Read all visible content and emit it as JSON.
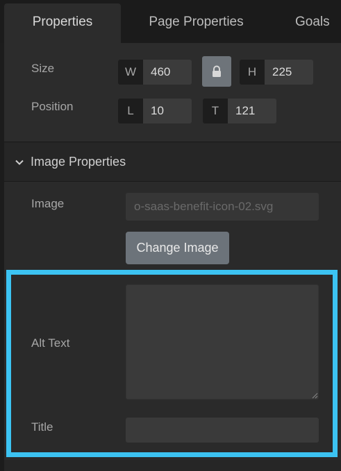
{
  "tabs": [
    {
      "label": "Properties",
      "active": true
    },
    {
      "label": "Page Properties",
      "active": false
    },
    {
      "label": "Goals",
      "active": false
    }
  ],
  "dimensions": {
    "size_label": "Size",
    "position_label": "Position",
    "width": {
      "prefix": "W",
      "value": "460"
    },
    "height": {
      "prefix": "H",
      "value": "225"
    },
    "left": {
      "prefix": "L",
      "value": "10"
    },
    "top": {
      "prefix": "T",
      "value": "121"
    },
    "lock_icon": "lock-icon"
  },
  "image_properties": {
    "header": "Image Properties",
    "header_icon": "chevron-down-icon",
    "image_label": "Image",
    "image_name": "o-saas-benefit-icon-02.svg",
    "change_button": "Change Image",
    "alt_text_label": "Alt Text",
    "alt_text_value": "",
    "title_label": "Title",
    "title_value": ""
  },
  "colors": {
    "highlight": "#3cc3f2",
    "panel_bg": "#2a2a2a",
    "button_bg": "#6c737a"
  }
}
